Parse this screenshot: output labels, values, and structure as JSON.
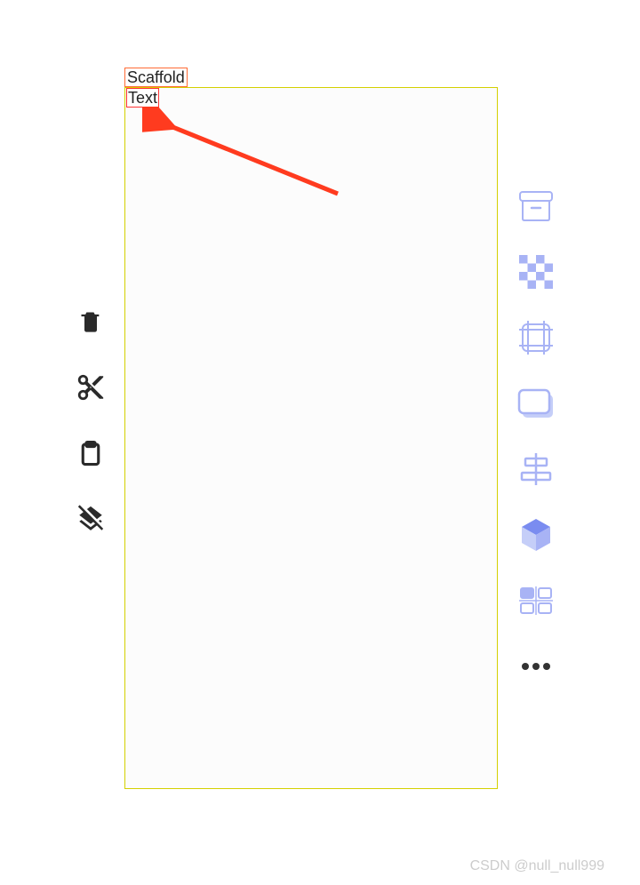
{
  "widgets": {
    "scaffold_label": "Scaffold",
    "text_label": "Text"
  },
  "left_toolbar": {
    "items": [
      "delete",
      "cut",
      "paste",
      "layers-off"
    ]
  },
  "right_toolbar": {
    "items": [
      "archive",
      "transparency",
      "bounds",
      "card",
      "align",
      "3d-box",
      "dashboard",
      "more"
    ]
  },
  "watermark": "CSDN @null_null999",
  "colors": {
    "arrow": "#ff3b1f",
    "right_icon": "#a8b3f5",
    "left_icon": "#2a2a2a",
    "more_icon": "#333333"
  }
}
